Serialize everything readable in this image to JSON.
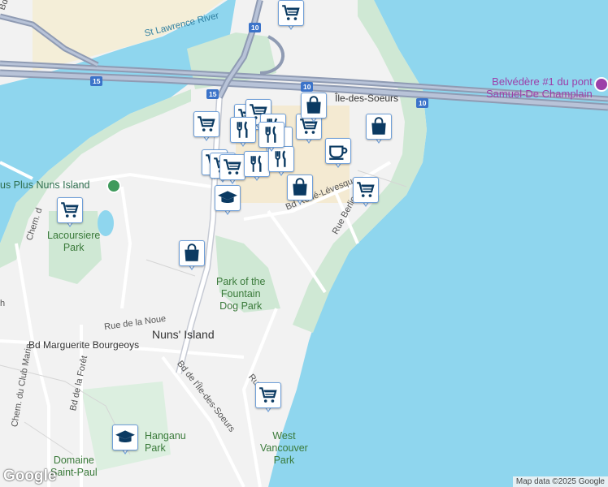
{
  "labels": {
    "st_lawrence": "St Lawrence River",
    "bd_gaetan": "Bd Gaé",
    "belvedere": "Belvédère #1 du pont Samuel-De Champlain",
    "belvedere_l1": "Belvédère #1 du pont",
    "belvedere_l2": "Samuel-De Champlain",
    "ile_des_soeurs": "Île-des-Soeurs",
    "nuns_plus": "us Plus Nuns Island",
    "lacoursiere_l1": "Lacoursiere",
    "lacoursiere_l2": "Park",
    "chem_l": "Chem. d",
    "fountain_l1": "Park of the",
    "fountain_l2": "Fountain",
    "fountain_l3": "Dog Park",
    "nuns_island": "Nuns' Island",
    "rue_de_la_noue": "Rue de la Noue",
    "bd_marguerite": "Bd Marguerite Bourgeoys",
    "chem_club": "Chem. du Club Marin",
    "bd_foret": "Bd de la Forêt",
    "bd_ile_soeurs": "Bd de l'Île-des-Soeurs",
    "rue_levesque": "Bd René-Lévesque",
    "rue_berlioz": "Rue Berlioz",
    "hanganu_l1": "Hanganu",
    "hanganu_l2": "Park",
    "domaine_l1": "Domaine",
    "domaine_l2": "Saint-Paul",
    "west_vancouver_l1": "West",
    "west_vancouver_l2": "Vancouver",
    "west_vancouver_l3": "Park",
    "ru": "Ru",
    "h": "h"
  },
  "shields": {
    "s10a": "10",
    "s15a": "15",
    "s15b": "15",
    "s10b": "10",
    "s10c": "10"
  },
  "markers": [
    {
      "icon": "cart"
    },
    {
      "icon": "utensils"
    },
    {
      "icon": "cart"
    },
    {
      "icon": "bag"
    },
    {
      "icon": "coffee"
    },
    {
      "icon": "cart"
    },
    {
      "icon": "bag"
    },
    {
      "icon": "graduation-cap"
    },
    {
      "icon": "bag"
    },
    {
      "icon": "cart"
    },
    {
      "icon": "graduation-cap"
    },
    {
      "icon": "cart"
    },
    {
      "icon": "bag"
    }
  ],
  "logo": "Google",
  "attribution": "Map data ©2025 Google",
  "colors": {
    "water": "#8fd6ee",
    "land": "#f2f2f2",
    "park": "#cfe8d4",
    "highway": "#8f9bb3",
    "marker_icon": "#0b3a62",
    "marker_border": "#6f9fd8"
  }
}
